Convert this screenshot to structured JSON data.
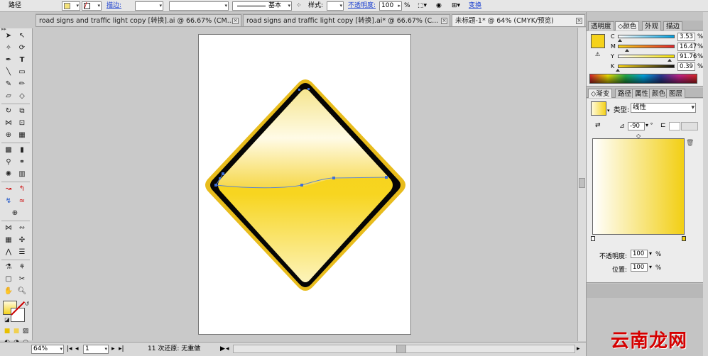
{
  "controlbar": {
    "object_type": "路径",
    "stroke_label": "描边:",
    "stroke_style": "基本",
    "style_label": "样式:",
    "opacity_label": "不透明度:",
    "opacity_value": "100",
    "opacity_unit": "%",
    "transform_label": "变换"
  },
  "tabs": [
    {
      "label": "road signs and traffic light copy [转换].ai @ 66.67% (CM..."
    },
    {
      "label": "road signs and traffic light copy [转换].ai* @ 66.67% (C..."
    },
    {
      "label": "未标题-1* @ 64% (CMYK/预览)"
    }
  ],
  "statusbar": {
    "zoom": "64%",
    "page": "1",
    "history": "11 次还原: 无重做"
  },
  "color_panel": {
    "tabs": [
      "透明度",
      "颜色",
      "外观",
      "描边"
    ],
    "active_tab": "颜色",
    "channels": [
      {
        "label": "C",
        "value": "3.53",
        "fraction": 0.0353
      },
      {
        "label": "M",
        "value": "16.47",
        "fraction": 0.1647
      },
      {
        "label": "Y",
        "value": "91.76",
        "fraction": 0.9176
      },
      {
        "label": "K",
        "value": "0.39",
        "fraction": 0.0039
      }
    ],
    "unit": "%",
    "fill_color": "#f5d21a"
  },
  "gradient_panel": {
    "tabs": [
      "渐变",
      "路径",
      "属性",
      "颜色",
      "图层"
    ],
    "active_tab": "渐变",
    "type_label": "类型:",
    "type_value": "线性",
    "angle_value": "-90",
    "opacity_label": "不透明度:",
    "opacity_value": "100",
    "location_label": "位置:",
    "location_value": "100",
    "unit": "%",
    "start_color": "#ffffff",
    "end_color": "#f2cf14"
  },
  "canvas": {
    "sign_fill": "#f7d316",
    "sign_border": "#e7b91c"
  },
  "watermark": "云南龙网"
}
